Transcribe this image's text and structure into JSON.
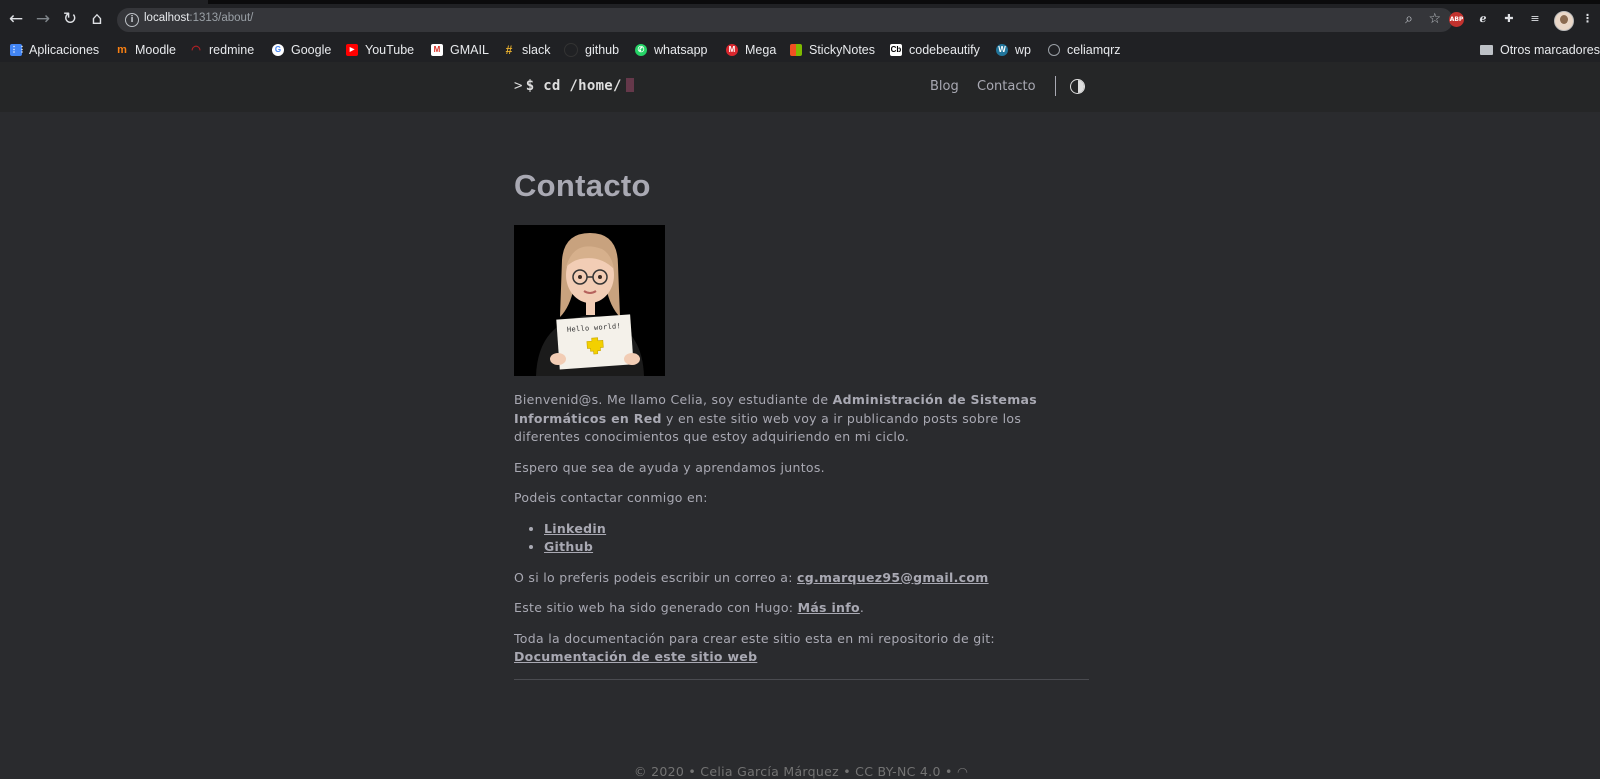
{
  "browser": {
    "url_host": "localhost",
    "url_path": ":1313/about/",
    "extensions": [
      "ABP"
    ]
  },
  "bookmarks": {
    "items": [
      {
        "label": "Aplicaciones",
        "icon": "apps-grid-icon",
        "color": "#e8453c"
      },
      {
        "label": "Moodle",
        "icon": "moodle-icon",
        "color": "#f98012"
      },
      {
        "label": "redmine",
        "icon": "redmine-icon",
        "color": "#b32024"
      },
      {
        "label": "Google",
        "icon": "google-icon",
        "color": "#ffffff"
      },
      {
        "label": "YouTube",
        "icon": "youtube-icon",
        "color": "#ff0000"
      },
      {
        "label": "GMAIL",
        "icon": "gmail-icon",
        "color": "#d93025"
      },
      {
        "label": "slack",
        "icon": "slack-icon",
        "color": "#ecb22e"
      },
      {
        "label": "github",
        "icon": "github-icon",
        "color": "#202124"
      },
      {
        "label": "whatsapp",
        "icon": "whatsapp-icon",
        "color": "#25d366"
      },
      {
        "label": "Mega",
        "icon": "mega-icon",
        "color": "#d9272e"
      },
      {
        "label": "StickyNotes",
        "icon": "stickynotes-icon",
        "color": "#f25022"
      },
      {
        "label": "codebeautify",
        "icon": "codebeautify-icon",
        "color": "#ffffff"
      },
      {
        "label": "wp",
        "icon": "wordpress-icon",
        "color": "#21759b"
      },
      {
        "label": "celiamqrz",
        "icon": "site-icon",
        "color": "#9aa0a6"
      }
    ],
    "other_label": "Otros marcadores"
  },
  "site": {
    "logo_prompt": ">",
    "logo_text": "$ cd /home/",
    "menu": [
      "Blog",
      "Contacto"
    ],
    "accent_cursor": "#65384a"
  },
  "page": {
    "title": "Contacto",
    "photo_caption": "Hello world!",
    "p1_a": "Bienvenid@s. Me llamo Celia, soy estudiante de ",
    "p1_b": "Administración de Sistemas Informáticos en Red",
    "p1_c": " y en este sitio web voy a ir publicando posts sobre los diferentes conocimientos que estoy adquiriendo en mi ciclo.",
    "p2": "Espero que sea de ayuda y aprendamos juntos.",
    "p3": "Podeis contactar conmigo en:",
    "links": [
      "Linkedin",
      "Github"
    ],
    "p4": "O si lo preferis podeis escribir un correo a: ",
    "email": "cg.marquez95@gmail.com",
    "p5": "Este sitio web ha sido generado con Hugo: ",
    "hugo_link": "Más info",
    "p5_end": ".",
    "p6": "Toda la documentación para crear este sitio esta en mi repositorio de git:",
    "docs_link": "Documentación de este sitio web"
  },
  "footer": {
    "text": "© 2020 • Celia García Márquez • CC BY-NC 4.0 •"
  }
}
